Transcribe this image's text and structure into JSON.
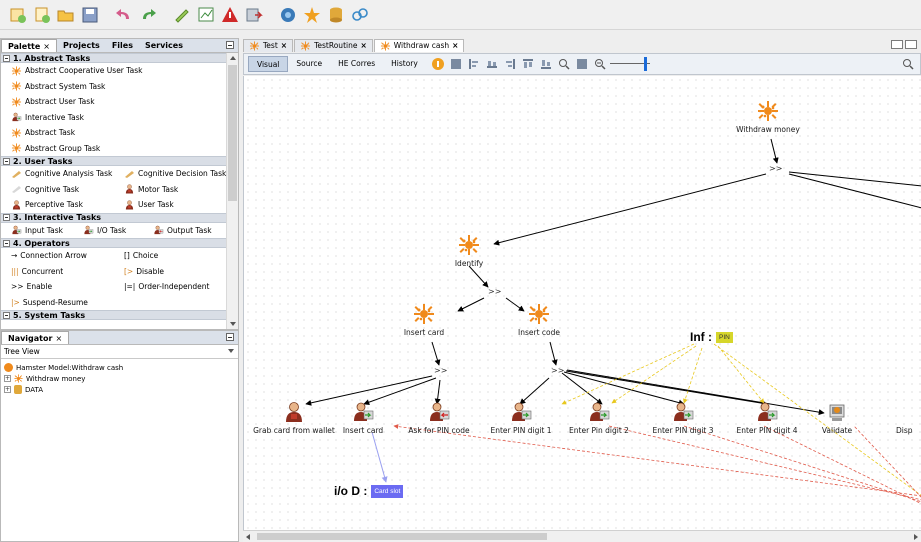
{
  "toolbar": {
    "buttons": [
      "new-project-icon",
      "new-file-icon",
      "open-project-icon",
      "save-icon",
      "undo-icon",
      "redo-icon",
      "validate-icon",
      "chart-icon",
      "warning-icon",
      "export-icon",
      "simulate-icon",
      "star-icon",
      "database-icon",
      "link-icon"
    ]
  },
  "palette_tabs": [
    {
      "label": "Palette",
      "close": "×"
    },
    {
      "label": "Projects"
    },
    {
      "label": "Files"
    },
    {
      "label": "Services"
    }
  ],
  "palette": {
    "categories": [
      {
        "label": "1. Abstract Tasks",
        "items": [
          "Abstract Cooperative User Task",
          "Abstract System Task",
          "Abstract User Task",
          "Interactive Task",
          "Abstract Task",
          "Abstract Group Task"
        ]
      },
      {
        "label": "2. User Tasks",
        "rows": [
          [
            "Cognitive Analysis Task",
            "Cognitive Decision Task"
          ],
          [
            "Cognitive Task",
            "Motor Task"
          ],
          [
            "Perceptive Task",
            "User Task"
          ]
        ]
      },
      {
        "label": "3. Interactive Tasks",
        "rows3": [
          "Input Task",
          "I/O Task",
          "Output Task"
        ]
      },
      {
        "label": "4. Operators",
        "rows": [
          [
            "Connection Arrow",
            "Choice"
          ],
          [
            "Concurrent",
            "Disable"
          ],
          [
            "Enable",
            "Order-Independent"
          ],
          [
            "Suspend-Resume",
            ""
          ]
        ],
        "symbols": [
          [
            "→",
            "[]"
          ],
          [
            "|||",
            "[>"
          ],
          [
            ">>",
            "|=|"
          ],
          [
            "|>",
            ""
          ]
        ]
      },
      {
        "label": "5. System Tasks"
      }
    ]
  },
  "navigator": {
    "tab": "Navigator",
    "close": "×",
    "view": "Tree View",
    "tree": [
      {
        "label": "Hamster Model:Withdraw cash",
        "icon": "hamster-icon"
      },
      {
        "label": "Withdraw money",
        "icon": "abstract-task-icon"
      },
      {
        "label": "DATA",
        "icon": "database-icon"
      }
    ]
  },
  "editor": {
    "tabs": [
      {
        "label": "Test",
        "close": "×"
      },
      {
        "label": "TestRoutine",
        "close": "×"
      },
      {
        "label": "Withdraw cash",
        "close": "×"
      }
    ],
    "views": [
      "Visual",
      "Source",
      "HE Corres",
      "History"
    ],
    "active_view": "Visual"
  },
  "diagram": {
    "root": "Withdraw money",
    "identify": "Identify",
    "insert_card_parent": "Insert card",
    "insert_code_parent": "Insert code",
    "operator": ">>",
    "leaves": [
      "Grab card from wallet",
      "Insert card",
      "Ask for PIN code",
      "Enter PIN digit 1",
      "Enter Pin digit 2",
      "Enter PIN digit 3",
      "Enter PIN digit 4",
      "Validate",
      "Disp"
    ],
    "inf_label": "Inf :",
    "inf_value": "PIN",
    "io_label": "i/o D :",
    "io_value": "Card slot",
    "colors": {
      "abstract": "#f08a1c",
      "inf_box": "#d6d62a",
      "io_box": "#6b6bf2",
      "inf_line": "#d4c81e",
      "io_line": "#9aa0f0",
      "red_line": "#e05a4a"
    }
  }
}
